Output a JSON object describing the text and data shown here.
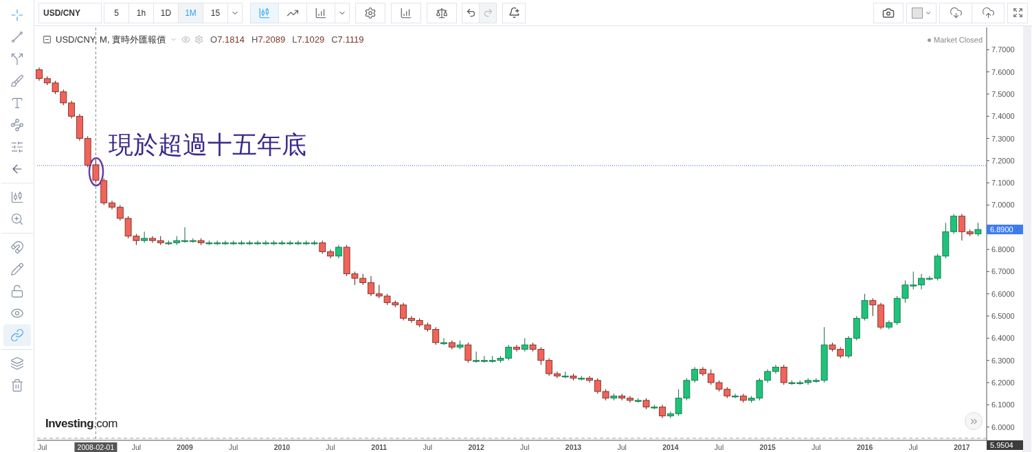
{
  "left_toolbar": [
    {
      "selected": true
    },
    {
      "selected": false
    },
    {
      "selected": false
    },
    {
      "selected": false
    },
    {
      "selected": false
    },
    {
      "selected": false
    },
    {
      "selected": false
    },
    {
      "selected": false
    },
    {
      "selected": false
    },
    {
      "selected": false
    },
    {
      "selected": false
    },
    {
      "selected": false
    },
    {
      "selected": false
    },
    {
      "selected": false
    },
    {
      "selected": true
    },
    {
      "selected": false
    },
    {
      "selected": false
    }
  ],
  "toolbar": {
    "symbol": "USD/CNY",
    "intervals": [
      {
        "label": "5",
        "selected": false
      },
      {
        "label": "1h",
        "selected": false
      },
      {
        "label": "1D",
        "selected": false
      },
      {
        "label": "1M",
        "selected": true
      },
      {
        "label": "15",
        "selected": false
      }
    ],
    "chart_types": [
      {
        "selected": true
      },
      {
        "selected": false
      },
      {
        "selected": false
      }
    ],
    "history": [
      {
        "disabled": false
      },
      {
        "disabled": true
      }
    ]
  },
  "legend": {
    "title": "USD/CNY, M, 實時外匯報價",
    "values": [
      {
        "label": "O",
        "value": "7.1814"
      },
      {
        "label": "H",
        "value": "7.2089"
      },
      {
        "label": "L",
        "value": "7.1029"
      },
      {
        "label": "C",
        "value": "7.1119"
      }
    ]
  },
  "status": "Market Closed",
  "annotation": "現於超過十五年底",
  "logo": "**Investing**.com",
  "crosshair_date": "2008-02-01",
  "last_price": "6.8900",
  "low_price": "5.9504",
  "chart_data": {
    "type": "candlestick",
    "categories": [
      "Jul",
      null,
      null,
      null,
      null,
      null,
      null,
      null,
      null,
      null,
      null,
      null,
      "Jul",
      null,
      null,
      null,
      null,
      null,
      "2009",
      null,
      null,
      null,
      null,
      null,
      "Jul",
      null,
      null,
      null,
      null,
      null,
      "2010",
      null,
      null,
      null,
      null,
      null,
      "Jul",
      null,
      null,
      null,
      null,
      null,
      "2011",
      null,
      null,
      null,
      null,
      null,
      "Jul",
      null,
      null,
      null,
      null,
      null,
      "2012",
      null,
      null,
      null,
      null,
      null,
      "Jul",
      null,
      null,
      null,
      null,
      null,
      "2013",
      null,
      null,
      null,
      null,
      null,
      "Jul",
      null,
      null,
      null,
      null,
      null,
      "2014",
      null,
      null,
      null,
      null,
      null,
      "Jul",
      null,
      null,
      null,
      null,
      null,
      "2015",
      null,
      null,
      null,
      null,
      null,
      "Jul",
      null,
      null,
      null,
      null,
      null,
      "2016",
      null,
      null,
      null,
      null,
      null,
      "Jul",
      null,
      null,
      null,
      null,
      null,
      "2017",
      null,
      null
    ],
    "ylim": [
      5.94,
      7.8
    ],
    "yticks": [
      {
        "value": 7.7,
        "label": "7.7000"
      },
      {
        "value": 7.6,
        "label": "7.6000"
      },
      {
        "value": 7.5,
        "label": "7.5000"
      },
      {
        "value": 7.4,
        "label": "7.4000"
      },
      {
        "value": 7.3,
        "label": "7.3000"
      },
      {
        "value": 7.2,
        "label": "7.2000"
      },
      {
        "value": 7.1,
        "label": "7.1000"
      },
      {
        "value": 7.0,
        "label": "7.0000"
      },
      {
        "value": 6.8,
        "label": "6.8000"
      },
      {
        "value": 6.7,
        "label": "6.7000"
      },
      {
        "value": 6.6,
        "label": "6.6000"
      },
      {
        "value": 6.5,
        "label": "6.5000"
      },
      {
        "value": 6.4,
        "label": "6.4000"
      },
      {
        "value": 6.3,
        "label": "6.3000"
      },
      {
        "value": 6.2,
        "label": "6.2000"
      },
      {
        "value": 6.1,
        "label": "6.1000"
      },
      {
        "value": 6.0,
        "label": "6.0000"
      }
    ],
    "ohlc": [
      [
        7.61,
        7.62,
        7.56,
        7.57
      ],
      [
        7.57,
        7.58,
        7.54,
        7.55
      ],
      [
        7.55,
        7.56,
        7.5,
        7.51
      ],
      [
        7.51,
        7.52,
        7.45,
        7.46
      ],
      [
        7.46,
        7.47,
        7.39,
        7.4
      ],
      [
        7.4,
        7.41,
        7.29,
        7.3
      ],
      [
        7.3,
        7.31,
        7.17,
        7.18
      ],
      [
        7.1814,
        7.2089,
        7.1029,
        7.1119
      ],
      [
        7.11,
        7.12,
        7.0,
        7.01
      ],
      [
        7.01,
        7.02,
        6.98,
        6.99
      ],
      [
        6.99,
        7.0,
        6.93,
        6.94
      ],
      [
        6.94,
        6.95,
        6.85,
        6.86
      ],
      [
        6.86,
        6.87,
        6.82,
        6.84
      ],
      [
        6.84,
        6.88,
        6.83,
        6.85
      ],
      [
        6.85,
        6.86,
        6.83,
        6.84
      ],
      [
        6.84,
        6.86,
        6.82,
        6.83
      ],
      [
        6.83,
        6.84,
        6.82,
        6.83
      ],
      [
        6.83,
        6.86,
        6.82,
        6.84
      ],
      [
        6.84,
        6.9,
        6.83,
        6.84
      ],
      [
        6.84,
        6.85,
        6.83,
        6.84
      ],
      [
        6.84,
        6.85,
        6.82,
        6.83
      ],
      [
        6.83,
        6.84,
        6.82,
        6.83
      ],
      [
        6.83,
        6.84,
        6.82,
        6.83
      ],
      [
        6.83,
        6.84,
        6.82,
        6.83
      ],
      [
        6.83,
        6.84,
        6.82,
        6.83
      ],
      [
        6.83,
        6.84,
        6.82,
        6.83
      ],
      [
        6.83,
        6.84,
        6.82,
        6.83
      ],
      [
        6.83,
        6.84,
        6.82,
        6.83
      ],
      [
        6.83,
        6.84,
        6.82,
        6.83
      ],
      [
        6.83,
        6.84,
        6.82,
        6.83
      ],
      [
        6.83,
        6.84,
        6.82,
        6.83
      ],
      [
        6.83,
        6.84,
        6.82,
        6.83
      ],
      [
        6.83,
        6.84,
        6.82,
        6.83
      ],
      [
        6.83,
        6.84,
        6.82,
        6.83
      ],
      [
        6.83,
        6.84,
        6.82,
        6.83
      ],
      [
        6.83,
        6.84,
        6.78,
        6.79
      ],
      [
        6.79,
        6.8,
        6.76,
        6.77
      ],
      [
        6.77,
        6.82,
        6.76,
        6.81
      ],
      [
        6.81,
        6.82,
        6.68,
        6.69
      ],
      [
        6.69,
        6.7,
        6.64,
        6.67
      ],
      [
        6.67,
        6.69,
        6.64,
        6.65
      ],
      [
        6.65,
        6.68,
        6.59,
        6.6
      ],
      [
        6.6,
        6.64,
        6.58,
        6.59
      ],
      [
        6.59,
        6.6,
        6.55,
        6.56
      ],
      [
        6.56,
        6.57,
        6.54,
        6.55
      ],
      [
        6.55,
        6.56,
        6.48,
        6.49
      ],
      [
        6.49,
        6.5,
        6.47,
        6.48
      ],
      [
        6.48,
        6.49,
        6.45,
        6.46
      ],
      [
        6.46,
        6.47,
        6.43,
        6.44
      ],
      [
        6.44,
        6.45,
        6.37,
        6.38
      ],
      [
        6.38,
        6.4,
        6.37,
        6.38
      ],
      [
        6.38,
        6.39,
        6.35,
        6.36
      ],
      [
        6.36,
        6.39,
        6.35,
        6.37
      ],
      [
        6.37,
        6.38,
        6.29,
        6.3
      ],
      [
        6.3,
        6.34,
        6.29,
        6.3
      ],
      [
        6.3,
        6.32,
        6.29,
        6.3
      ],
      [
        6.3,
        6.32,
        6.29,
        6.3
      ],
      [
        6.3,
        6.32,
        6.29,
        6.31
      ],
      [
        6.31,
        6.37,
        6.3,
        6.36
      ],
      [
        6.36,
        6.37,
        6.34,
        6.35
      ],
      [
        6.35,
        6.4,
        6.34,
        6.37
      ],
      [
        6.37,
        6.38,
        6.34,
        6.35
      ],
      [
        6.35,
        6.36,
        6.28,
        6.3
      ],
      [
        6.3,
        6.31,
        6.23,
        6.24
      ],
      [
        6.24,
        6.25,
        6.22,
        6.23
      ],
      [
        6.23,
        6.25,
        6.22,
        6.23
      ],
      [
        6.23,
        6.24,
        6.21,
        6.22
      ],
      [
        6.22,
        6.23,
        6.21,
        6.22
      ],
      [
        6.22,
        6.23,
        6.2,
        6.21
      ],
      [
        6.21,
        6.22,
        6.15,
        6.16
      ],
      [
        6.16,
        6.17,
        6.12,
        6.13
      ],
      [
        6.13,
        6.15,
        6.12,
        6.14
      ],
      [
        6.14,
        6.15,
        6.12,
        6.13
      ],
      [
        6.13,
        6.14,
        6.11,
        6.12
      ],
      [
        6.12,
        6.13,
        6.11,
        6.12
      ],
      [
        6.12,
        6.13,
        6.08,
        6.09
      ],
      [
        6.09,
        6.1,
        6.08,
        6.09
      ],
      [
        6.09,
        6.1,
        6.04,
        6.05
      ],
      [
        6.05,
        6.07,
        6.04,
        6.06
      ],
      [
        6.06,
        6.17,
        6.05,
        6.13
      ],
      [
        6.13,
        6.22,
        6.12,
        6.21
      ],
      [
        6.21,
        6.27,
        6.2,
        6.26
      ],
      [
        6.26,
        6.27,
        6.23,
        6.24
      ],
      [
        6.24,
        6.26,
        6.19,
        6.2
      ],
      [
        6.2,
        6.21,
        6.16,
        6.17
      ],
      [
        6.17,
        6.18,
        6.13,
        6.14
      ],
      [
        6.14,
        6.15,
        6.13,
        6.14
      ],
      [
        6.14,
        6.15,
        6.11,
        6.12
      ],
      [
        6.12,
        6.14,
        6.11,
        6.13
      ],
      [
        6.13,
        6.22,
        6.12,
        6.21
      ],
      [
        6.21,
        6.26,
        6.2,
        6.25
      ],
      [
        6.25,
        6.28,
        6.24,
        6.27
      ],
      [
        6.27,
        6.28,
        6.19,
        6.2
      ],
      [
        6.2,
        6.21,
        6.19,
        6.2
      ],
      [
        6.2,
        6.21,
        6.19,
        6.2
      ],
      [
        6.2,
        6.22,
        6.19,
        6.21
      ],
      [
        6.21,
        6.22,
        6.2,
        6.21
      ],
      [
        6.21,
        6.45,
        6.2,
        6.37
      ],
      [
        6.37,
        6.38,
        6.34,
        6.35
      ],
      [
        6.35,
        6.36,
        6.31,
        6.32
      ],
      [
        6.32,
        6.41,
        6.31,
        6.4
      ],
      [
        6.4,
        6.5,
        6.39,
        6.49
      ],
      [
        6.49,
        6.6,
        6.48,
        6.57
      ],
      [
        6.57,
        6.58,
        6.5,
        6.55
      ],
      [
        6.55,
        6.56,
        6.44,
        6.45
      ],
      [
        6.45,
        6.48,
        6.44,
        6.47
      ],
      [
        6.47,
        6.59,
        6.46,
        6.58
      ],
      [
        6.58,
        6.66,
        6.56,
        6.64
      ],
      [
        6.64,
        6.7,
        6.62,
        6.64
      ],
      [
        6.64,
        6.69,
        6.62,
        6.67
      ],
      [
        6.67,
        6.68,
        6.66,
        6.67
      ],
      [
        6.67,
        6.78,
        6.66,
        6.77
      ],
      [
        6.77,
        6.92,
        6.76,
        6.88
      ],
      [
        6.88,
        6.96,
        6.87,
        6.95
      ],
      [
        6.95,
        6.96,
        6.84,
        6.88
      ],
      [
        6.88,
        6.89,
        6.86,
        6.87
      ],
      [
        6.87,
        6.92,
        6.86,
        6.89
      ]
    ]
  }
}
